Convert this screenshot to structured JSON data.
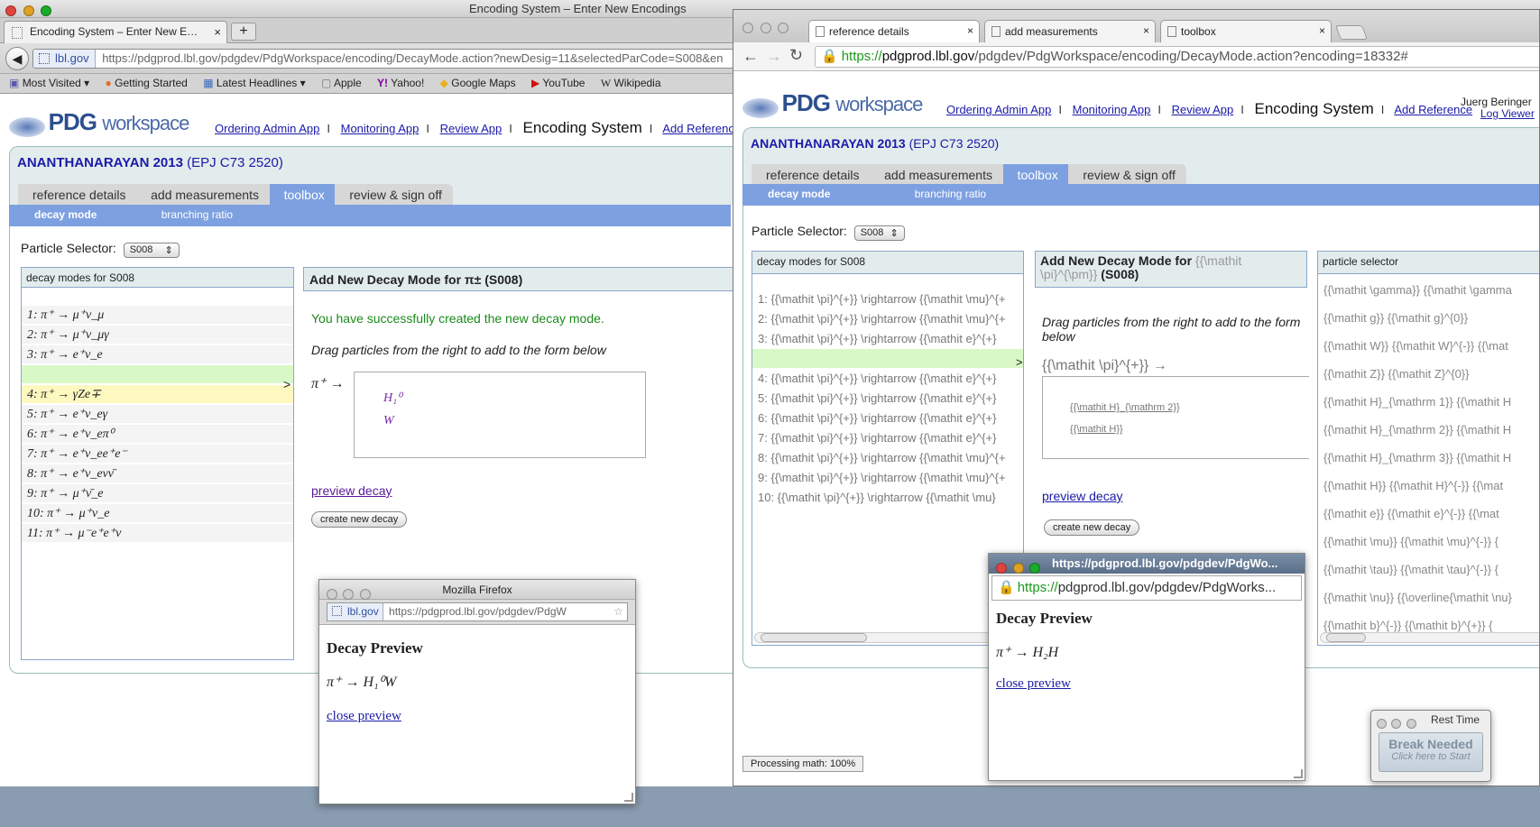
{
  "ff": {
    "window_title": "Encoding System – Enter New Encodings",
    "tab_title": "Encoding System – Enter New E…",
    "new_tab": "+",
    "url_domain": "lbl.gov",
    "url": "https://pdgprod.lbl.gov/pdgdev/PdgWorkspace/encoding/DecayMode.action?newDesig=11&selectedParCode=S008&en",
    "bookmarks": [
      "Most Visited ▾",
      "Getting Started",
      "Latest Headlines ▾",
      "Apple",
      "Yahoo!",
      "Google Maps",
      "YouTube",
      "Wikipedia"
    ],
    "logo_pdg": "PDG",
    "logo_ws": "workspace",
    "nav": [
      "Ordering Admin App",
      "Monitoring App",
      "Review App"
    ],
    "nav_current": "Encoding System",
    "nav_add": "Add Reference",
    "reference_name": "ANANTHANARAYAN 2013",
    "reference_journal": "(EPJ C73 2520)",
    "tabs": [
      "reference details",
      "add measurements",
      "toolbox",
      "review & sign off"
    ],
    "subtabs": [
      "decay mode",
      "branching ratio"
    ],
    "particle_selector_label": "Particle Selector:",
    "particle_selector_value": "S008",
    "list_header": "decay modes for S008",
    "decay_modes": [
      "1:  π⁺ → μ⁺ν_μ",
      "2:  π⁺ → μ⁺ν_μγ",
      "3:  π⁺ → e⁺ν_e",
      "",
      "4:  π⁺ → γZe∓",
      "5:  π⁺ → e⁺ν_eγ",
      "6:  π⁺ → e⁺ν_eπ⁰",
      "7:  π⁺ → e⁺ν_ee⁺e⁻",
      "8:  π⁺ → e⁺ν_eνν̄",
      "9:  π⁺ → μ⁺ν̄_e",
      "10:  π⁺ → μ⁺ν_e",
      "11:  π⁺ → μ⁻e⁺e⁺ν"
    ],
    "insert_marker": ">",
    "add_title": "Add New Decay Mode for π± (S008)",
    "success_msg": "You have successfully created the new decay mode.",
    "drag_hint": "Drag particles from the right to add to the form below",
    "decay_lhs": "π⁺ →",
    "dropped": [
      "H₁⁰",
      "W"
    ],
    "preview_link": "preview decay",
    "create_btn": "create new decay"
  },
  "ff_popup": {
    "title": "Mozilla Firefox",
    "url_domain": "lbl.gov",
    "url": "https://pdgprod.lbl.gov/pdgdev/PdgW",
    "heading": "Decay Preview",
    "formula": "π⁺ → H₁⁰W",
    "close": "close preview"
  },
  "cr": {
    "tabs": [
      "reference details",
      "add measurements",
      "toolbox",
      "review & sign off"
    ],
    "url_scheme": "https://",
    "url_host": "pdgprod.lbl.gov",
    "url_path": "/pdgdev/PdgWorkspace/encoding/DecayMode.action?encoding=18332#",
    "logo_pdg": "PDG",
    "logo_ws": "workspace",
    "nav": [
      "Ordering Admin App",
      "Monitoring App",
      "Review App"
    ],
    "nav_current": "Encoding System",
    "nav_add": "Add Reference",
    "user": "Juerg Beringer",
    "logviewer": "Log Viewer",
    "reference_name": "ANANTHANARAYAN 2013",
    "reference_journal": "(EPJ C73 2520)",
    "subtabs": [
      "decay mode",
      "branching ratio"
    ],
    "particle_selector_label": "Particle Selector:",
    "particle_selector_value": "S008",
    "list_header": "decay modes for S008",
    "decay_modes": [
      "1:  {{\\mathit \\pi}^{+}} \\rightarrow {{\\mathit \\mu}^{+",
      "2:  {{\\mathit \\pi}^{+}} \\rightarrow {{\\mathit \\mu}^{+",
      "3:  {{\\mathit \\pi}^{+}} \\rightarrow {{\\mathit e}^{+}",
      "",
      "4:  {{\\mathit \\pi}^{+}} \\rightarrow {{\\mathit e}^{+}",
      "5:  {{\\mathit \\pi}^{+}} \\rightarrow {{\\mathit e}^{+}",
      "6:  {{\\mathit \\pi}^{+}} \\rightarrow {{\\mathit e}^{+}",
      "7:  {{\\mathit \\pi}^{+}} \\rightarrow {{\\mathit e}^{+}",
      "8:  {{\\mathit \\pi}^{+}} \\rightarrow {{\\mathit \\mu}^{+",
      "9:  {{\\mathit \\pi}^{+}} \\rightarrow {{\\mathit \\mu}^{+",
      "10:  {{\\mathit \\pi}^{+}} \\rightarrow {{\\mathit \\mu}"
    ],
    "insert_marker": ">",
    "add_title_prefix": "Add New Decay Mode for",
    "add_title_tex": "{{\\mathit \\pi}^{\\pm}}",
    "add_title_code": "(S008)",
    "drag_hint": "Drag particles from the right to add to the form below",
    "decay_lhs": "{{\\mathit \\pi}^{+}} →",
    "dropped": [
      "{{\\mathit H}_{\\mathrm 2}}",
      "{{\\mathit H}}"
    ],
    "preview_link": "preview decay",
    "create_btn": "create new decay",
    "particle_header": "particle selector",
    "particles": [
      "{{\\mathit \\gamma}}   {{\\mathit \\gamma",
      "{{\\mathit g}}   {{\\mathit g}^{0}}",
      "{{\\mathit W}}   {{\\mathit W}^{-}}   {{\\mat",
      "{{\\mathit Z}}   {{\\mathit Z}^{0}}",
      "{{\\mathit H}_{\\mathrm 1}}   {{\\mathit H",
      "{{\\mathit H}_{\\mathrm 2}}   {{\\mathit H",
      "{{\\mathit H}_{\\mathrm 3}}   {{\\mathit H",
      "{{\\mathit H}}   {{\\mathit H}^{-}}   {{\\mat",
      "{{\\mathit e}}   {{\\mathit e}^{-}}   {{\\mat",
      "{{\\mathit \\mu}}   {{\\mathit \\mu}^{-}}   {",
      "{{\\mathit \\tau}}   {{\\mathit \\tau}^{-}}   {",
      "{{\\mathit \\nu}}   {{\\overline{\\mathit \\nu}",
      "{{\\mathit b}^{-}}   {{\\mathit b}^{+}}   {"
    ],
    "status": "Processing math: 100%"
  },
  "cr_popup": {
    "title": "https://pdgprod.lbl.gov/pdgdev/PdgWo...",
    "url_scheme": "https://",
    "url_rest": "pdgprod.lbl.gov/pdgdev/PdgWorks...",
    "heading": "Decay Preview",
    "formula": "π⁺ → H₂H",
    "close": "close preview"
  },
  "rest": {
    "title": "Rest Time",
    "button": "Break Needed",
    "hint": "Click here to Start"
  },
  "colors": {
    "tab_active": "#7da0e0",
    "success": "#1a8a1a",
    "highlight_green": "#d8f8c8",
    "highlight_yellow": "#fcf8c0",
    "link": "#1a1aa8"
  }
}
